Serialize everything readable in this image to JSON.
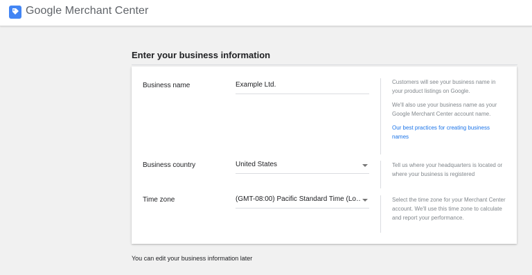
{
  "header": {
    "brand_google": "Google",
    "brand_product": "Merchant Center",
    "logo_icon": "merchant-center-tag-icon",
    "accent_color": "#4285f4"
  },
  "form": {
    "title": "Enter your business information",
    "rows": [
      {
        "label": "Business name",
        "value": "Example Ltd.",
        "type": "text",
        "help": [
          "Customers will see your business name in your product listings on Google.",
          "We'll also use your business name as your Google Merchant Center account name."
        ],
        "help_link": "Our best practices for creating business names"
      },
      {
        "label": "Business country",
        "value": "United States",
        "type": "select",
        "help": [
          "Tell us where your headquarters is located or where your business is registered"
        ]
      },
      {
        "label": "Time zone",
        "value": "(GMT-08:00) Pacific Standard Time (Lo…",
        "type": "select",
        "help": [
          "Select the time zone for your Merchant Center account. We'll use this time zone to calculate and report your performance."
        ]
      }
    ]
  },
  "footer_note": "You can edit your business information later",
  "colors": {
    "link": "#1a73e8",
    "page_bg": "#f1f1f1",
    "text": "#202124",
    "muted": "#80868b"
  }
}
